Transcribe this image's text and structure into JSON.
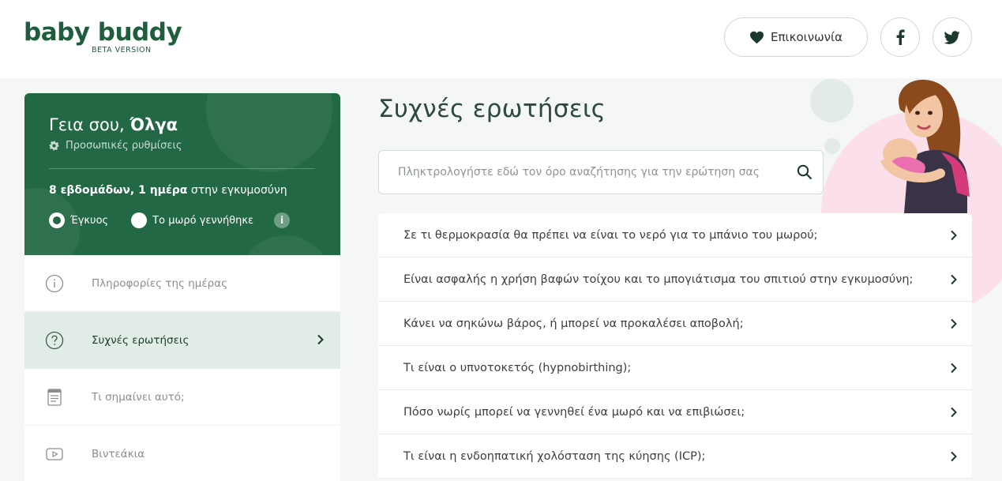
{
  "header": {
    "logo_text": "baby buddy",
    "logo_sub": "BETA VERSION",
    "contact_label": "Επικοινωνία",
    "facebook_icon": "facebook-icon",
    "twitter_icon": "twitter-icon"
  },
  "profile": {
    "greeting_prefix": "Γεια σου,",
    "user_name": "Όλγα",
    "settings_label": "Προσωπικές ρυθμίσεις",
    "weeks_bold": "8 εβδομάδων, 1 ημέρα",
    "weeks_rest": " στην εγκυμοσύνη",
    "radio_pregnant": "Έγκυος",
    "radio_born": "Το μωρό γεννήθηκε",
    "selected_radio": "pregnant",
    "info_symbol": "i"
  },
  "sidebar": {
    "items": [
      {
        "label": "Πληροφορίες της ημέρας",
        "icon": "info-icon",
        "active": false
      },
      {
        "label": "Συχνές ερωτήσεις",
        "icon": "question-icon",
        "active": true
      },
      {
        "label": "Τι σημαίνει αυτό;",
        "icon": "document-icon",
        "active": false
      },
      {
        "label": "Βιντεάκια",
        "icon": "video-icon",
        "active": false
      }
    ]
  },
  "main": {
    "title": "Συχνές ερωτήσεις",
    "search_placeholder": "Πληκτρολογήστε εδώ τον όρο αναζήτησης για την ερώτηση σας",
    "faqs": [
      "Σε τι θερμοκρασία θα πρέπει να είναι το νερό για το μπάνιο του μωρού;",
      "Είναι ασφαλής η χρήση βαφών τοίχου και το μπογιάτισμα του σπιτιού στην εγκυμοσύνη;",
      "Κάνει να σηκώνω βάρος, ή μπορεί να προκαλέσει αποβολή;",
      "Τι είναι ο υπνοτοκετός (hypnobirthing);",
      "Πόσο νωρίς μπορεί να γεννηθεί ένα μωρό και να επιβιώσει;",
      "Τι είναι η ενδοηπατική χολόσταση της κύησης (ICP);"
    ]
  },
  "colors": {
    "brand_green": "#226845",
    "logo_green": "#1e5e3c",
    "active_bg": "#e2ede7",
    "page_bg": "#f4f7f6",
    "pink": "#fbe0ec"
  }
}
